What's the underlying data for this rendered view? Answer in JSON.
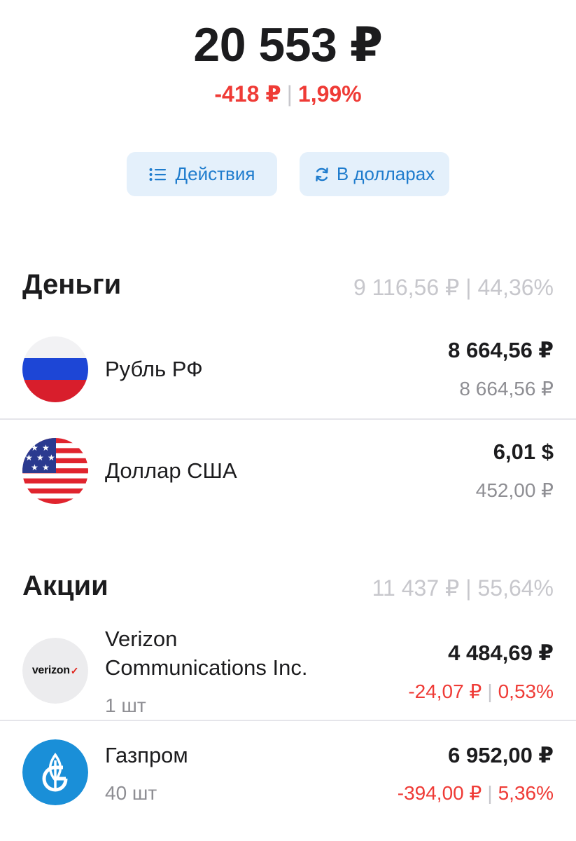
{
  "header": {
    "total": "20 553 ₽",
    "change_abs": "-418 ₽",
    "change_pct": "1,99%"
  },
  "actions": {
    "actions_label": "Действия",
    "usd_label": "В долларах"
  },
  "money": {
    "title": "Деньги",
    "summary": "9 116,56 ₽ | 44,36%",
    "items": [
      {
        "name": "Рубль РФ",
        "amount": "8 664,56 ₽",
        "rub_value": "8 664,56 ₽",
        "icon": "russia-flag-icon"
      },
      {
        "name": "Доллар США",
        "amount": "6,01 $",
        "rub_value": "452,00 ₽",
        "icon": "usa-flag-icon"
      }
    ]
  },
  "stocks": {
    "title": "Акции",
    "summary": "11 437 ₽ | 55,64%",
    "items": [
      {
        "name_line1": "Verizon",
        "name_line2": "Communications Inc.",
        "qty": "1 шт",
        "amount": "4 484,69 ₽",
        "change_abs": "-24,07 ₽",
        "change_pct": "0,53%",
        "logo_text": "verizon",
        "logo_mark": "✓",
        "icon": "verizon-logo"
      },
      {
        "name": "Газпром",
        "qty": "40 шт",
        "amount": "6 952,00 ₽",
        "change_abs": "-394,00 ₽",
        "change_pct": "5,36%",
        "icon": "gazprom-logo"
      }
    ]
  },
  "colors": {
    "negative": "#ef3b36",
    "accent": "#1f7ccd",
    "button_bg": "#e4f0fb",
    "muted": "#8e8e93"
  }
}
